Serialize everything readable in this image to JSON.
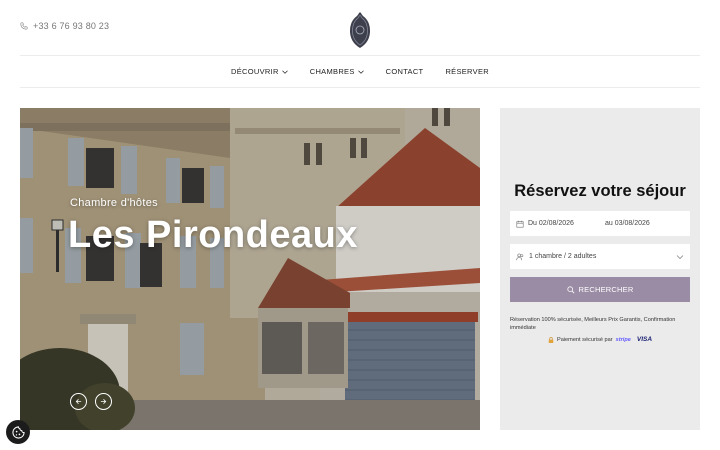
{
  "header": {
    "phone": "+33 6 76 93 80 23",
    "icons": {
      "phone": "phone-icon",
      "logo": "logo-crest"
    }
  },
  "nav": {
    "items": [
      {
        "label": "DÉCOUVRIR",
        "has_dropdown": true
      },
      {
        "label": "CHAMBRES",
        "has_dropdown": true
      },
      {
        "label": "CONTACT",
        "has_dropdown": false
      },
      {
        "label": "RÉSERVER",
        "has_dropdown": false
      }
    ]
  },
  "hero": {
    "subtitle": "Chambre d'hôtes",
    "title": "Les Pirondeaux",
    "controls": [
      "arrow-left-icon",
      "arrow-right-icon"
    ]
  },
  "booking": {
    "title": "Réservez votre séjour",
    "date_from": "Du 02/08/2026",
    "date_to": "au 03/08/2026",
    "guests": "1 chambre / 2 adultes",
    "search_label": "RECHERCHER",
    "note": "Réservation 100% sécurisée, Meilleurs Prix Garantis, Confirmation immédiate",
    "secure_label": "Paiement sécurisé par",
    "secure_providers": [
      "stripe",
      "VISA"
    ]
  },
  "colors": {
    "accent": "#9b8ca5",
    "panel_bg": "#ebebeb",
    "cookie_bg": "#1c1c1c"
  }
}
